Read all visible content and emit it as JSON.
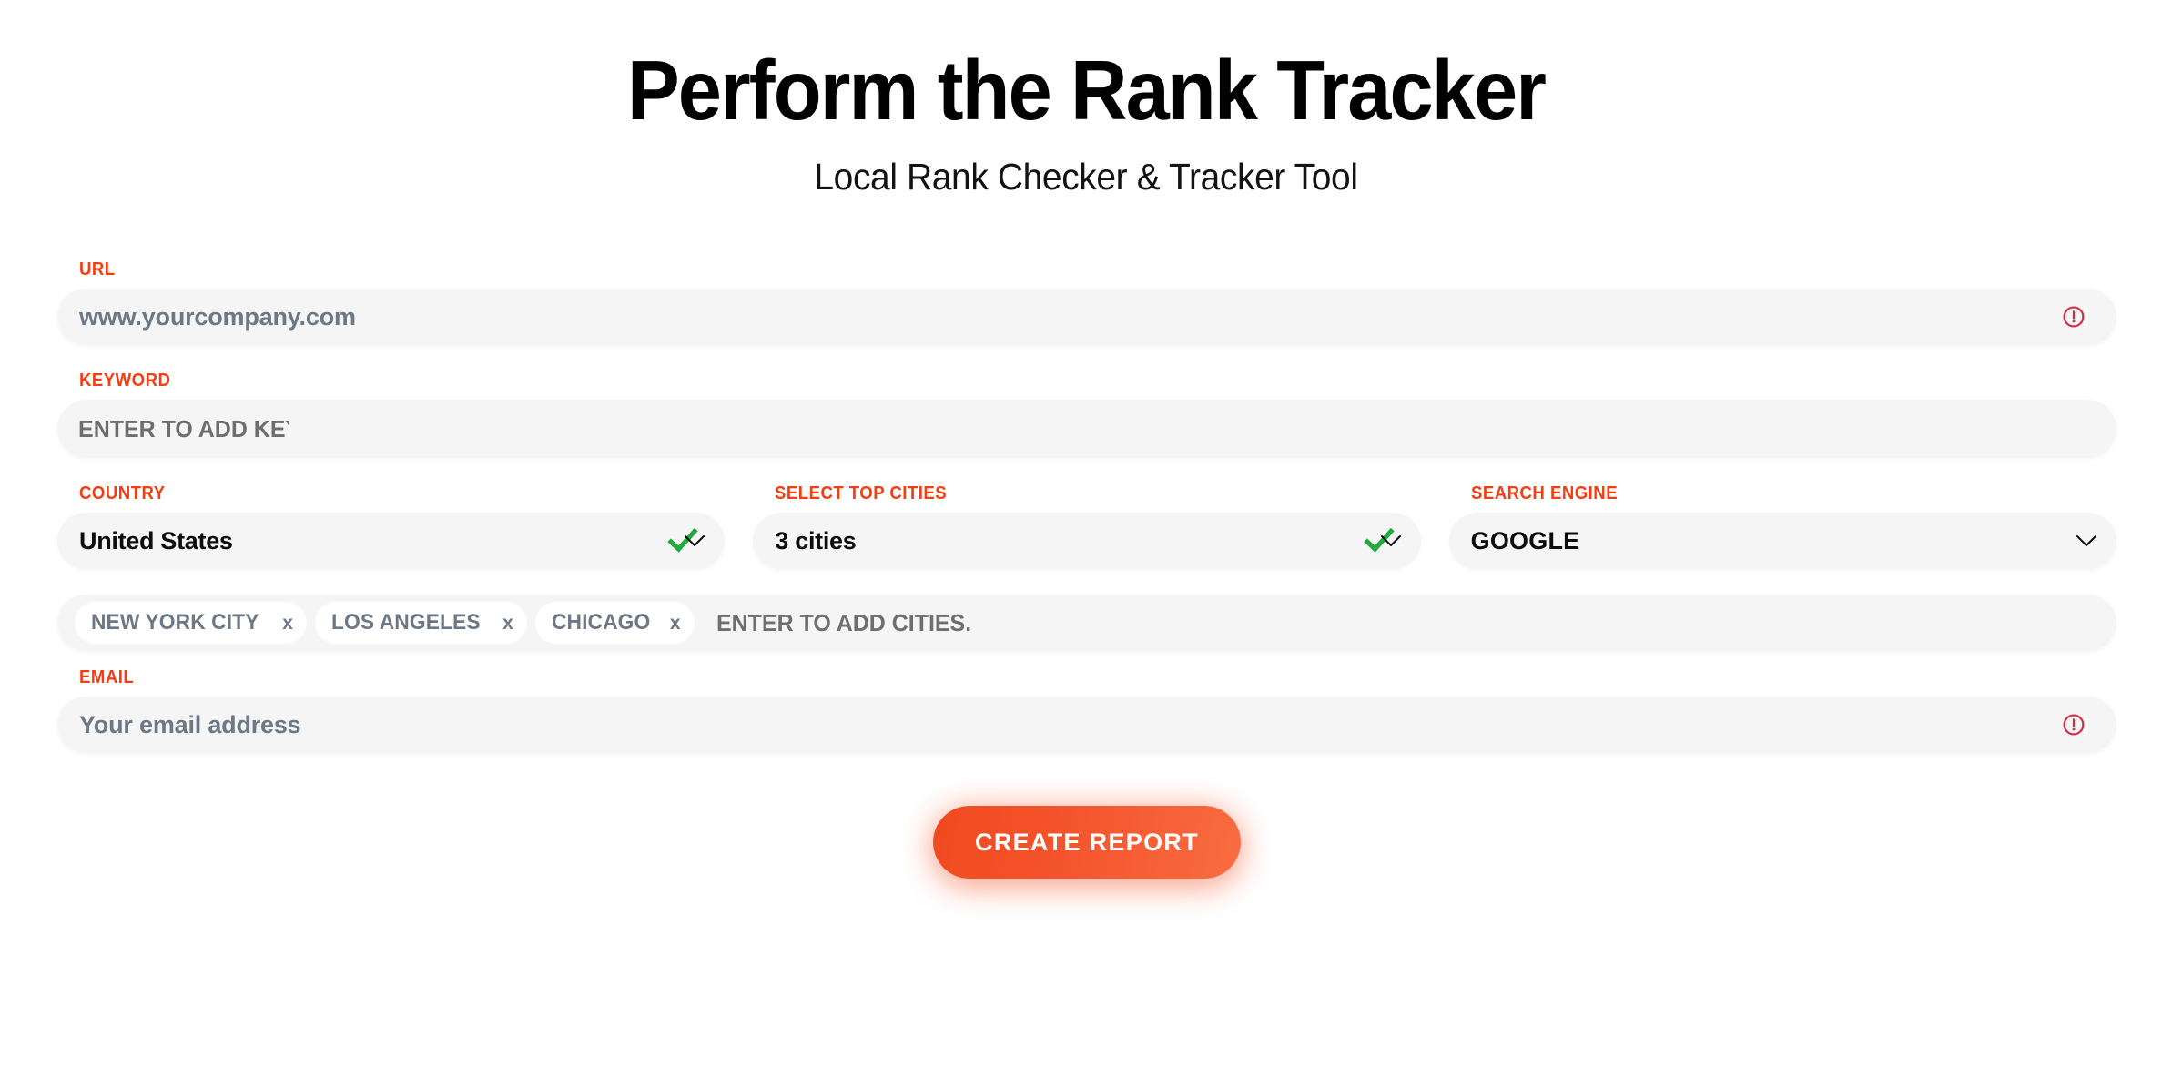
{
  "header": {
    "title": "Perform the Rank Tracker",
    "subtitle": "Local Rank Checker & Tracker Tool"
  },
  "colors": {
    "label_orange": "#F63C11",
    "field_background": "#F5F5F5",
    "placeholder_gray": "#6C7885",
    "check_green": "#22A83F",
    "alert_red": "#D62B42",
    "button_gradient_start": "#F04A1F",
    "button_gradient_end": "#F96C41"
  },
  "form": {
    "url": {
      "label": "URL",
      "placeholder": "www.yourcompany.com",
      "value": "",
      "status_icon": "alert-circle-icon"
    },
    "keyword": {
      "label": "KEYWORD",
      "placeholder": "ENTER TO ADD KEYWORD",
      "placeholder_rendered": "ENTER TO ADD KEYWORI",
      "value": ""
    },
    "country": {
      "label": "COUNTRY",
      "value": "United States",
      "icons": [
        "check-icon",
        "chevron-down-icon"
      ]
    },
    "top_cities": {
      "label": "SELECT TOP CITIES",
      "value": "3 cities",
      "icons": [
        "check-icon",
        "chevron-down-icon"
      ]
    },
    "search_engine": {
      "label": "SEARCH ENGINE",
      "value": "GOOGLE",
      "icons": [
        "chevron-down-icon"
      ]
    },
    "cities": {
      "tags": [
        {
          "label": "NEW YORK CITY",
          "remove": "x"
        },
        {
          "label": "LOS ANGELES",
          "remove": "x"
        },
        {
          "label": "CHICAGO",
          "remove": "x"
        }
      ],
      "placeholder": "ENTER TO ADD CITIES."
    },
    "email": {
      "label": "EMAIL",
      "placeholder": "Your email address",
      "value": "",
      "status_icon": "alert-circle-icon"
    },
    "submit": {
      "label": "CREATE REPORT"
    }
  }
}
